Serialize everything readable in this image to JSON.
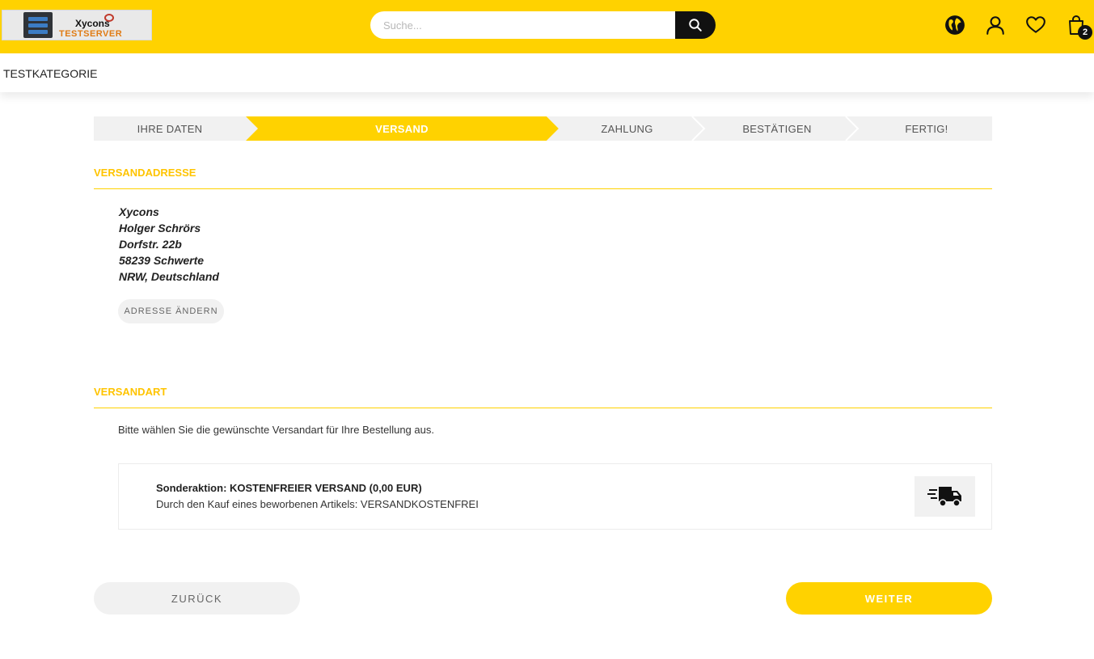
{
  "brand": {
    "logo_name": "Xycons",
    "logo_sub": "TESTSERVER"
  },
  "search": {
    "placeholder": "Suche..."
  },
  "header_icons": [
    "globe-icon",
    "user-icon",
    "heart-icon",
    "cart-icon"
  ],
  "cart": {
    "count": "2"
  },
  "nav": {
    "items": [
      {
        "label": "TESTKATEGORIE"
      }
    ]
  },
  "steps": [
    {
      "label": "IHRE DATEN",
      "state": "done"
    },
    {
      "label": "VERSAND",
      "state": "active"
    },
    {
      "label": "ZAHLUNG",
      "state": "pending"
    },
    {
      "label": "BESTÄTIGEN",
      "state": "pending"
    },
    {
      "label": "FERTIG!",
      "state": "pending"
    }
  ],
  "shipping_address": {
    "title": "VERSANDADRESSE",
    "lines": [
      "Xycons",
      "Holger Schrörs",
      "Dorfstr. 22b",
      "58239 Schwerte",
      "NRW, Deutschland"
    ],
    "change_label": "ADRESSE ÄNDERN"
  },
  "shipping_method": {
    "title": "VERSANDART",
    "info": "Bitte wählen Sie die gewünschte Versandart für Ihre Bestellung aus.",
    "option": {
      "title": "Sonderaktion: KOSTENFREIER VERSAND (0,00 EUR)",
      "description": "Durch den Kauf eines beworbenen Artikels: VERSANDKOSTENFREI",
      "icon": "delivery-truck-icon"
    }
  },
  "actions": {
    "back_label": "ZURÜCK",
    "next_label": "WEITER"
  },
  "colors": {
    "brand_yellow": "#FFD200",
    "section_title": "#FFC400",
    "step_inactive": "#F1F1F1",
    "dark": "#111111"
  }
}
